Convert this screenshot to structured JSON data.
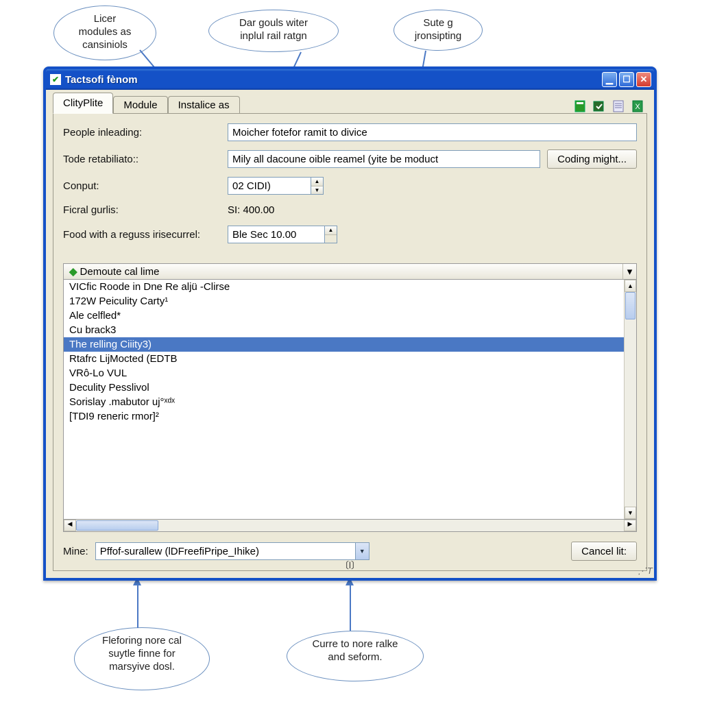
{
  "callouts": {
    "top_left": "Licer\nmodules as\ncansiniols",
    "top_mid": "Dar gouls witer\ninplul rail ratgn",
    "top_right": "Sute g\njronsipting",
    "bot_left": "Fleforing nore cal\nsuytle finne for\nmarsyive dosl.",
    "bot_right": "Curre to nore ralke\nand seform."
  },
  "window": {
    "title": "Tactsofi fènom"
  },
  "tabs": [
    "ClityPlite",
    "Module",
    "Instalice as"
  ],
  "form": {
    "people_label": "People inleading:",
    "people_value": "Moicher fotefor ramit to divice",
    "tode_label": "Tode retabiliato::",
    "tode_value": "Mily all dacoune oible reamel (yite be moduct",
    "coding_btn": "Coding might...",
    "conput_label": "Conput:",
    "conput_value": "02 CIDI)",
    "ficral_label": "Ficral gurlis:",
    "ficral_value": "SI: 400.00",
    "food_label": "Food with a reguss irisecurrel:",
    "food_value": "Ble Sec 10.00"
  },
  "list": {
    "header": "Demoute cal lime",
    "items": [
      "VICfic Roode in Dne Re aljü -Clirse",
      "172W Peiculity Carty¹",
      "Ale celfled*",
      "Cu brack3",
      "The relling Ciiity3)",
      "Rtafrc LijMocted (EDTB",
      "VRô-Lo VUL",
      "Deculity Pesslivol",
      "Sorislay .mabutor uj°ˣᵈˣ",
      "[TDI9 reneric rmor]²"
    ],
    "selected_index": 4
  },
  "bottom": {
    "mine_label": "Mine:",
    "mine_value": "Pffof-surallew (lDFreefiPripe_Ihike)",
    "cancel": "Cancel lit:"
  }
}
